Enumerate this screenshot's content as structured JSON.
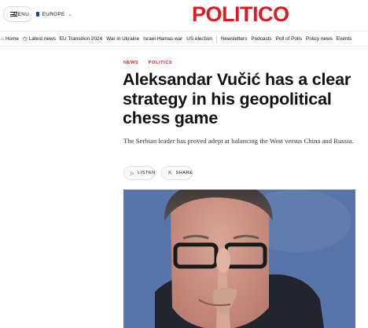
{
  "header": {
    "menu_label": "MENU",
    "edition_label": "EUROPE",
    "logo_text": "POLITICO",
    "brand_color": "#dc1a22"
  },
  "nav": {
    "items": [
      {
        "label": "Home",
        "icon": "home-icon"
      },
      {
        "label": "Latest news",
        "icon": "clock-icon"
      },
      {
        "label": "EU Transition 2024"
      },
      {
        "label": "War in Ukraine"
      },
      {
        "label": "Israel-Hamas war"
      },
      {
        "label": "US election"
      },
      {
        "label": "Newsletters"
      },
      {
        "label": "Podcasts"
      },
      {
        "label": "Poll of Polls"
      },
      {
        "label": "Policy news"
      },
      {
        "label": "Events"
      }
    ]
  },
  "article": {
    "crumbs": [
      "NEWS",
      "POLITICS"
    ],
    "headline": "Aleksandar Vučić has a clear strategy in his geopolitical chess game",
    "dek": "The Serbian leader has proved adept at balancing the West versus China and Russia.",
    "listen_label": "LISTEN",
    "share_label": "SHARE"
  }
}
